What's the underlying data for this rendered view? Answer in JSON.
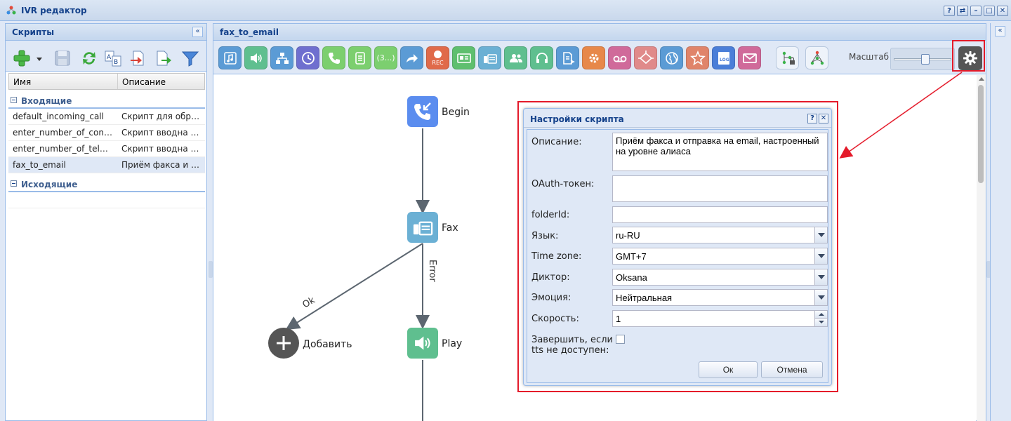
{
  "window": {
    "title": "IVR редактор",
    "controls": [
      "?",
      "⇄",
      "–",
      "□",
      "✕"
    ]
  },
  "left_panel": {
    "title": "Скрипты",
    "collapse_glyph": "«",
    "toolbar_icons": [
      "add-icon",
      "dropdown-arrow-icon",
      "save-icon",
      "refresh-icon",
      "rename-icon",
      "import-icon",
      "export-icon",
      "filter-icon"
    ],
    "columns": [
      "Имя",
      "Описание"
    ],
    "groups": [
      {
        "label": "Входящие",
        "rows": [
          {
            "name": "default_incoming_call",
            "description": "Скрипт для обраб…"
          },
          {
            "name": "enter_number_of_confe…",
            "description": "Скрипт вводна но…"
          },
          {
            "name": "enter_number_of_telec…",
            "description": "Скрипт вводна но…"
          },
          {
            "name": "fax_to_email",
            "description": "Приём факса и от…",
            "selected": true
          }
        ]
      },
      {
        "label": "Исходящие",
        "rows": []
      }
    ]
  },
  "main_panel": {
    "title": "fax_to_email",
    "toolbar": {
      "buttons": [
        {
          "icon": "music-icon",
          "color": "#5b9bd5"
        },
        {
          "icon": "play-sound-icon",
          "color": "#5fbf8f"
        },
        {
          "icon": "menu-tree-icon",
          "color": "#5b9bd5"
        },
        {
          "icon": "clock-icon",
          "color": "#6f6fcf"
        },
        {
          "icon": "phone-icon",
          "color": "#7ccf6f"
        },
        {
          "icon": "document-list-icon",
          "color": "#7ccf6f"
        },
        {
          "icon": "counter-icon",
          "color": "#7ccf6f",
          "text": "(3...)"
        },
        {
          "icon": "forward-arrow-icon",
          "color": "#5b9bd5"
        },
        {
          "icon": "record-icon",
          "color": "#e06a4a",
          "text": "REC"
        },
        {
          "icon": "card-icon",
          "color": "#5fbf6f"
        },
        {
          "icon": "fax-icon",
          "color": "#6bb0d4"
        },
        {
          "icon": "group-icon",
          "color": "#5fbf8f"
        },
        {
          "icon": "headset-icon",
          "color": "#5fbf8f"
        },
        {
          "icon": "document-arrow-icon",
          "color": "#5b9bd5"
        },
        {
          "icon": "settings-icon",
          "color": "#e7884a"
        },
        {
          "icon": "voicemail-icon",
          "color": "#d06a9a"
        },
        {
          "icon": "condition-icon",
          "color": "#e08a8a"
        },
        {
          "icon": "globe-icon",
          "color": "#5b9bd5"
        },
        {
          "icon": "star-icon",
          "color": "#e0846a"
        },
        {
          "icon": "log-icon",
          "color": "#4a7ed8",
          "text": "LOG"
        },
        {
          "icon": "mail-icon",
          "color": "#d06a9a"
        },
        {
          "icon": "locked-tree-icon",
          "color": "#eef3fa"
        },
        {
          "icon": "tree-icon",
          "color": "#eef3fa"
        }
      ],
      "scale_label": "Масштаб",
      "scale_level": 0.55,
      "settings_icon": "gear-icon"
    },
    "canvas": {
      "nodes": [
        {
          "id": "begin",
          "label": "Begin",
          "icon": "incoming-call-icon",
          "color": "#5b8def"
        },
        {
          "id": "fax",
          "label": "Fax",
          "icon": "fax-icon",
          "color": "#6bb0d4"
        },
        {
          "id": "play",
          "label": "Play",
          "icon": "play-sound-icon",
          "color": "#5fbf8f"
        },
        {
          "id": "add",
          "label": "Добавить",
          "icon": "plus-icon",
          "color": "#555555"
        }
      ],
      "edges": [
        {
          "from": "begin",
          "to": "fax",
          "label": ""
        },
        {
          "from": "fax",
          "to": "add",
          "label": "Ok"
        },
        {
          "from": "fax",
          "to": "play",
          "label": "Error"
        }
      ]
    }
  },
  "dialog": {
    "title": "Настройки скрипта",
    "help_glyph": "?",
    "close_glyph": "✕",
    "fields": {
      "description": {
        "label": "Описание:",
        "value": "Приём факса и отправка на email, настроенный на уровне алиаса"
      },
      "oauth": {
        "label": "OAuth-токен:",
        "value": ""
      },
      "folder": {
        "label": "folderId:",
        "value": ""
      },
      "language": {
        "label": "Язык:",
        "value": "ru-RU"
      },
      "timezone": {
        "label": "Time zone:",
        "value": "GMT+7"
      },
      "speaker": {
        "label": "Диктор:",
        "value": "Oksana"
      },
      "emotion": {
        "label": "Эмоция:",
        "value": "Нейтральная"
      },
      "speed": {
        "label": "Скорость:",
        "value": "1"
      },
      "finish_if_tts_unavailable": {
        "label_line1": "Завершить, если",
        "label_line2": "tts не доступен:",
        "checked": false
      }
    },
    "ok_label": "Ок",
    "cancel_label": "Отмена"
  },
  "colors": {
    "highlight": "#e41a2a",
    "header_text": "#15428b",
    "panel_bg": "#dfe8f6"
  }
}
